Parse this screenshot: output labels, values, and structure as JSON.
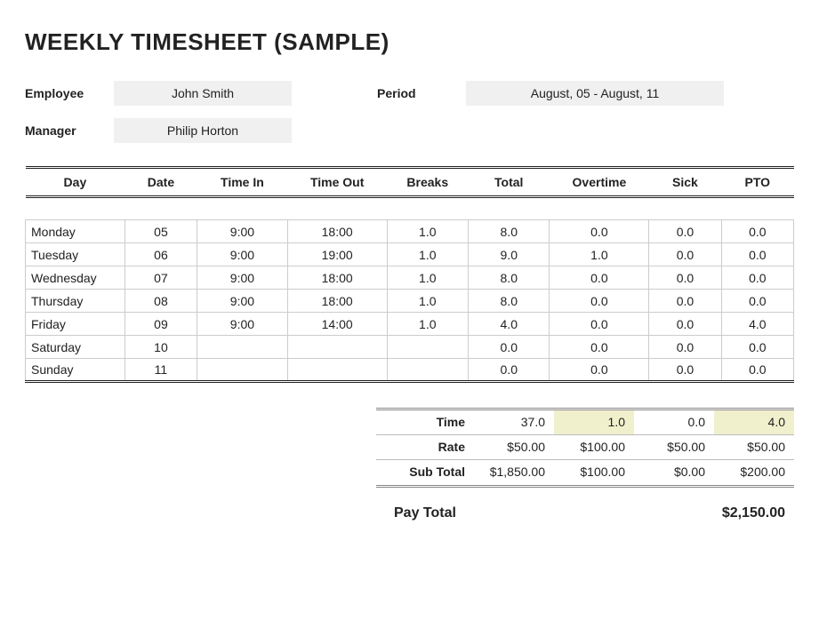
{
  "title": "WEEKLY TIMESHEET (SAMPLE)",
  "meta": {
    "employee_label": "Employee",
    "employee_value": "John Smith",
    "period_label": "Period",
    "period_value": "August, 05 - August, 11",
    "manager_label": "Manager",
    "manager_value": "Philip Horton"
  },
  "headers": {
    "day": "Day",
    "date": "Date",
    "time_in": "Time In",
    "time_out": "Time Out",
    "breaks": "Breaks",
    "total": "Total",
    "overtime": "Overtime",
    "sick": "Sick",
    "pto": "PTO"
  },
  "rows": [
    {
      "day": "Monday",
      "date": "05",
      "in": "9:00",
      "out": "18:00",
      "breaks": "1.0",
      "total": "8.0",
      "ot": "0.0",
      "sick": "0.0",
      "pto": "0.0"
    },
    {
      "day": "Tuesday",
      "date": "06",
      "in": "9:00",
      "out": "19:00",
      "breaks": "1.0",
      "total": "9.0",
      "ot": "1.0",
      "sick": "0.0",
      "pto": "0.0"
    },
    {
      "day": "Wednesday",
      "date": "07",
      "in": "9:00",
      "out": "18:00",
      "breaks": "1.0",
      "total": "8.0",
      "ot": "0.0",
      "sick": "0.0",
      "pto": "0.0"
    },
    {
      "day": "Thursday",
      "date": "08",
      "in": "9:00",
      "out": "18:00",
      "breaks": "1.0",
      "total": "8.0",
      "ot": "0.0",
      "sick": "0.0",
      "pto": "0.0"
    },
    {
      "day": "Friday",
      "date": "09",
      "in": "9:00",
      "out": "14:00",
      "breaks": "1.0",
      "total": "4.0",
      "ot": "0.0",
      "sick": "0.0",
      "pto": "4.0"
    },
    {
      "day": "Saturday",
      "date": "10",
      "in": "",
      "out": "",
      "breaks": "",
      "total": "0.0",
      "ot": "0.0",
      "sick": "0.0",
      "pto": "0.0"
    },
    {
      "day": "Sunday",
      "date": "11",
      "in": "",
      "out": "",
      "breaks": "",
      "total": "0.0",
      "ot": "0.0",
      "sick": "0.0",
      "pto": "0.0"
    }
  ],
  "summary": {
    "time_label": "Time",
    "rate_label": "Rate",
    "subtotal_label": "Sub Total",
    "time": {
      "total": "37.0",
      "ot": "1.0",
      "sick": "0.0",
      "pto": "4.0"
    },
    "rate": {
      "total": "$50.00",
      "ot": "$100.00",
      "sick": "$50.00",
      "pto": "$50.00"
    },
    "subtotal": {
      "total": "$1,850.00",
      "ot": "$100.00",
      "sick": "$0.00",
      "pto": "$200.00"
    }
  },
  "paytotal": {
    "label": "Pay Total",
    "value": "$2,150.00"
  },
  "chart_data": {
    "type": "table",
    "title": "Weekly Timesheet (Sample)",
    "columns": [
      "Day",
      "Date",
      "Time In",
      "Time Out",
      "Breaks",
      "Total",
      "Overtime",
      "Sick",
      "PTO"
    ],
    "rows": [
      [
        "Monday",
        "05",
        "9:00",
        "18:00",
        1.0,
        8.0,
        0.0,
        0.0,
        0.0
      ],
      [
        "Tuesday",
        "06",
        "9:00",
        "19:00",
        1.0,
        9.0,
        1.0,
        0.0,
        0.0
      ],
      [
        "Wednesday",
        "07",
        "9:00",
        "18:00",
        1.0,
        8.0,
        0.0,
        0.0,
        0.0
      ],
      [
        "Thursday",
        "08",
        "9:00",
        "18:00",
        1.0,
        8.0,
        0.0,
        0.0,
        0.0
      ],
      [
        "Friday",
        "09",
        "9:00",
        "14:00",
        1.0,
        4.0,
        0.0,
        0.0,
        4.0
      ],
      [
        "Saturday",
        "10",
        "",
        "",
        "",
        0.0,
        0.0,
        0.0,
        0.0
      ],
      [
        "Sunday",
        "11",
        "",
        "",
        "",
        0.0,
        0.0,
        0.0,
        0.0
      ]
    ],
    "totals": {
      "Time": 37.0,
      "Overtime": 1.0,
      "Sick": 0.0,
      "PTO": 4.0
    },
    "rates": {
      "Total": 50.0,
      "Overtime": 100.0,
      "Sick": 50.0,
      "PTO": 50.0
    },
    "subtotals": {
      "Total": 1850.0,
      "Overtime": 100.0,
      "Sick": 0.0,
      "PTO": 200.0
    },
    "pay_total": 2150.0
  }
}
